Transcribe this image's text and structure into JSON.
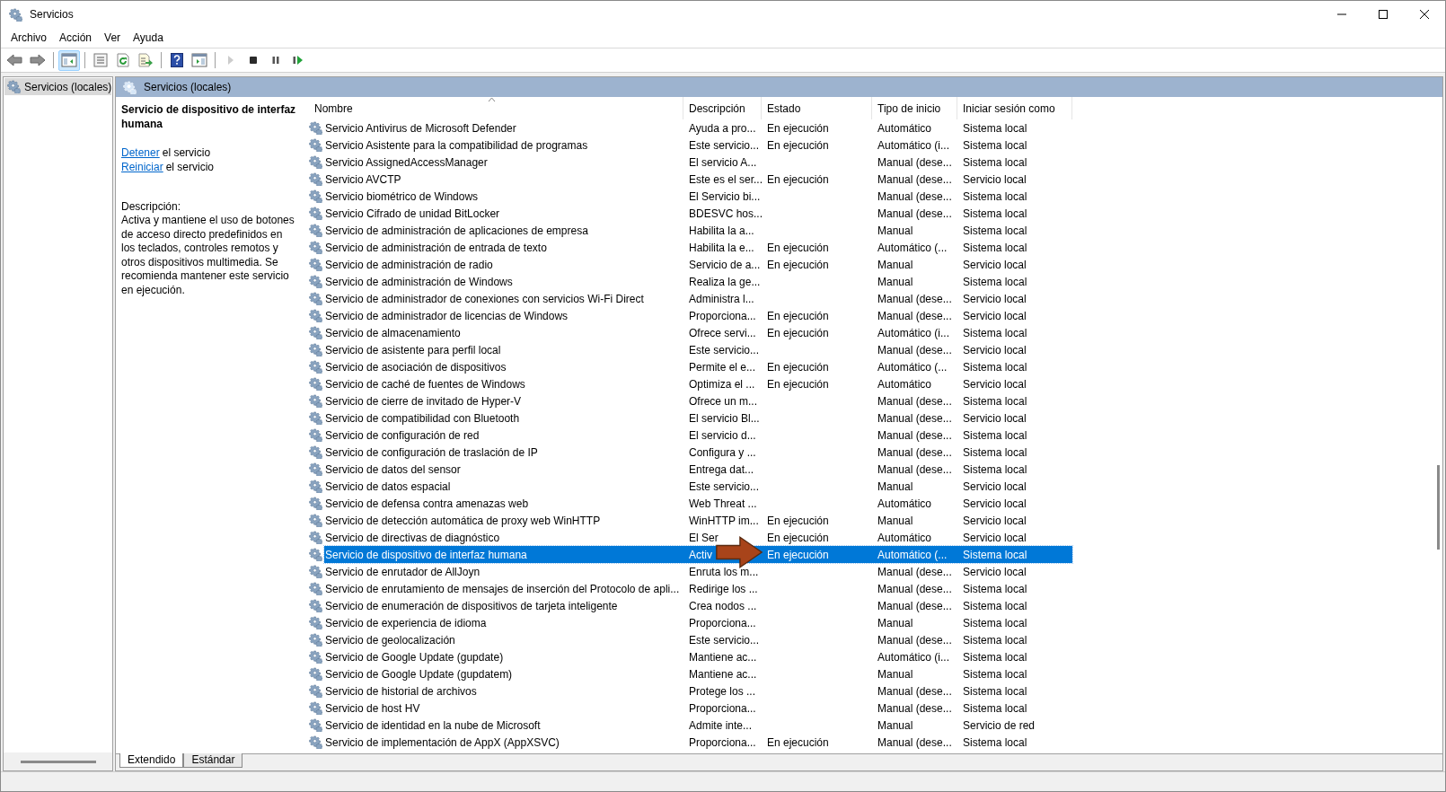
{
  "window": {
    "title": "Servicios"
  },
  "menu": [
    "Archivo",
    "Acción",
    "Ver",
    "Ayuda"
  ],
  "toolbar": [
    {
      "kind": "back",
      "selected": false,
      "disabled": false
    },
    {
      "kind": "forward",
      "selected": false,
      "disabled": false
    },
    {
      "kind": "sep"
    },
    {
      "kind": "tree",
      "selected": true,
      "disabled": false
    },
    {
      "kind": "sep"
    },
    {
      "kind": "properties",
      "selected": false,
      "disabled": false
    },
    {
      "kind": "refresh",
      "selected": false,
      "disabled": false
    },
    {
      "kind": "export",
      "selected": false,
      "disabled": false
    },
    {
      "kind": "sep"
    },
    {
      "kind": "help",
      "selected": false,
      "disabled": false
    },
    {
      "kind": "pane",
      "selected": false,
      "disabled": false
    },
    {
      "kind": "sep"
    },
    {
      "kind": "play",
      "selected": false,
      "disabled": true
    },
    {
      "kind": "stop",
      "selected": false,
      "disabled": false
    },
    {
      "kind": "pause",
      "selected": false,
      "disabled": false
    },
    {
      "kind": "resume",
      "selected": false,
      "disabled": false
    }
  ],
  "tree": {
    "items": [
      {
        "label": "Servicios (locales)",
        "selected": true
      }
    ]
  },
  "panel_header": "Servicios (locales)",
  "details": {
    "title": "Servicio de dispositivo de interfaz humana",
    "actions": [
      {
        "link": "Detener",
        "text": "el servicio"
      },
      {
        "link": "Reiniciar",
        "text": "el servicio"
      }
    ],
    "description_label": "Descripción:",
    "description": "Activa y mantiene el uso de botones de acceso directo predefinidos en los teclados, controles remotos y otros dispositivos multimedia. Se recomienda mantener este servicio en ejecución."
  },
  "table": {
    "columns": [
      {
        "label": "Nombre",
        "sorted": true
      },
      {
        "label": "Descripción",
        "sorted": false
      },
      {
        "label": "Estado",
        "sorted": false
      },
      {
        "label": "Tipo de inicio",
        "sorted": false
      },
      {
        "label": "Iniciar sesión como",
        "sorted": false
      }
    ],
    "rows": [
      {
        "name": "Servicio Antivirus de Microsoft Defender",
        "description": "Ayuda a pro...",
        "status": "En ejecución",
        "startup": "Automático",
        "logon": "Sistema local",
        "selected": false
      },
      {
        "name": "Servicio Asistente para la compatibilidad de programas",
        "description": "Este servicio...",
        "status": "En ejecución",
        "startup": "Automático (i...",
        "logon": "Sistema local",
        "selected": false
      },
      {
        "name": "Servicio AssignedAccessManager",
        "description": "El servicio A...",
        "startup": "Manual (dese...",
        "logon": "Sistema local",
        "selected": false
      },
      {
        "name": "Servicio AVCTP",
        "description": "Este es el ser...",
        "status": "En ejecución",
        "startup": "Manual (dese...",
        "logon": "Servicio local",
        "selected": false
      },
      {
        "name": "Servicio biométrico de Windows",
        "description": "El Servicio bi...",
        "startup": "Manual (dese...",
        "logon": "Sistema local",
        "selected": false
      },
      {
        "name": "Servicio Cifrado de unidad BitLocker",
        "description": "BDESVC hos...",
        "startup": "Manual (dese...",
        "logon": "Sistema local",
        "selected": false
      },
      {
        "name": "Servicio de administración de aplicaciones de empresa",
        "description": "Habilita la a...",
        "startup": "Manual",
        "logon": "Sistema local",
        "selected": false
      },
      {
        "name": "Servicio de administración de entrada de texto",
        "description": "Habilita la e...",
        "status": "En ejecución",
        "startup": "Automático (...",
        "logon": "Sistema local",
        "selected": false
      },
      {
        "name": "Servicio de administración de radio",
        "description": "Servicio de a...",
        "status": "En ejecución",
        "startup": "Manual",
        "logon": "Servicio local",
        "selected": false
      },
      {
        "name": "Servicio de administración de Windows",
        "description": "Realiza la ge...",
        "startup": "Manual",
        "logon": "Sistema local",
        "selected": false
      },
      {
        "name": "Servicio de administrador de conexiones con servicios Wi-Fi Direct",
        "description": "Administra l...",
        "startup": "Manual (dese...",
        "logon": "Servicio local",
        "selected": false
      },
      {
        "name": "Servicio de administrador de licencias de Windows",
        "description": "Proporciona...",
        "status": "En ejecución",
        "startup": "Manual (dese...",
        "logon": "Servicio local",
        "selected": false
      },
      {
        "name": "Servicio de almacenamiento",
        "description": "Ofrece servi...",
        "status": "En ejecución",
        "startup": "Automático (i...",
        "logon": "Sistema local",
        "selected": false
      },
      {
        "name": "Servicio de asistente para perfil local",
        "description": "Este servicio...",
        "startup": "Manual (dese...",
        "logon": "Servicio local",
        "selected": false
      },
      {
        "name": "Servicio de asociación de dispositivos",
        "description": "Permite el e...",
        "status": "En ejecución",
        "startup": "Automático (...",
        "logon": "Sistema local",
        "selected": false
      },
      {
        "name": "Servicio de caché de fuentes de Windows",
        "description": "Optimiza el ...",
        "status": "En ejecución",
        "startup": "Automático",
        "logon": "Servicio local",
        "selected": false
      },
      {
        "name": "Servicio de cierre de invitado de Hyper-V",
        "description": "Ofrece un m...",
        "startup": "Manual (dese...",
        "logon": "Sistema local",
        "selected": false
      },
      {
        "name": "Servicio de compatibilidad con Bluetooth",
        "description": "El servicio Bl...",
        "startup": "Manual (dese...",
        "logon": "Servicio local",
        "selected": false
      },
      {
        "name": "Servicio de configuración de red",
        "description": "El servicio d...",
        "startup": "Manual (dese...",
        "logon": "Sistema local",
        "selected": false
      },
      {
        "name": "Servicio de configuración de traslación de IP",
        "description": "Configura y ...",
        "startup": "Manual (dese...",
        "logon": "Sistema local",
        "selected": false
      },
      {
        "name": "Servicio de datos del sensor",
        "description": "Entrega dat...",
        "startup": "Manual (dese...",
        "logon": "Sistema local",
        "selected": false
      },
      {
        "name": "Servicio de datos espacial",
        "description": "Este servicio...",
        "startup": "Manual",
        "logon": "Servicio local",
        "selected": false
      },
      {
        "name": "Servicio de defensa contra amenazas web",
        "description": "Web Threat ...",
        "startup": "Automático",
        "logon": "Servicio local",
        "selected": false
      },
      {
        "name": "Servicio de detección automática de proxy web WinHTTP",
        "description": "WinHTTP im...",
        "status": "En ejecución",
        "startup": "Manual",
        "logon": "Servicio local",
        "selected": false
      },
      {
        "name": "Servicio de directivas de diagnóstico",
        "description": "El Ser",
        "status": "En ejecución",
        "startup": "Automático",
        "logon": "Servicio local",
        "selected": false
      },
      {
        "name": "Servicio de dispositivo de interfaz humana",
        "description": "Activ",
        "status": "En ejecución",
        "startup": "Automático (...",
        "logon": "Sistema local",
        "selected": true
      },
      {
        "name": "Servicio de enrutador de AllJoyn",
        "description": "Enruta los m...",
        "startup": "Manual (dese...",
        "logon": "Servicio local",
        "selected": false
      },
      {
        "name": "Servicio de enrutamiento de mensajes de inserción del Protocolo de apli...",
        "description": "Redirige los ...",
        "startup": "Manual (dese...",
        "logon": "Sistema local",
        "selected": false
      },
      {
        "name": "Servicio de enumeración de dispositivos de tarjeta inteligente",
        "description": "Crea nodos ...",
        "startup": "Manual (dese...",
        "logon": "Sistema local",
        "selected": false
      },
      {
        "name": "Servicio de experiencia de idioma",
        "description": "Proporciona...",
        "startup": "Manual",
        "logon": "Sistema local",
        "selected": false
      },
      {
        "name": "Servicio de geolocalización",
        "description": "Este servicio...",
        "startup": "Manual (dese...",
        "logon": "Sistema local",
        "selected": false
      },
      {
        "name": "Servicio de Google Update (gupdate)",
        "description": "Mantiene ac...",
        "startup": "Automático (i...",
        "logon": "Sistema local",
        "selected": false
      },
      {
        "name": "Servicio de Google Update (gupdatem)",
        "description": "Mantiene ac...",
        "startup": "Manual",
        "logon": "Sistema local",
        "selected": false
      },
      {
        "name": "Servicio de historial de archivos",
        "description": "Protege los ...",
        "startup": "Manual (dese...",
        "logon": "Sistema local",
        "selected": false
      },
      {
        "name": "Servicio de host HV",
        "description": "Proporciona...",
        "startup": "Manual (dese...",
        "logon": "Sistema local",
        "selected": false
      },
      {
        "name": "Servicio de identidad en la nube de Microsoft",
        "description": "Admite inte...",
        "startup": "Manual",
        "logon": "Servicio de red",
        "selected": false
      },
      {
        "name": "Servicio de implementación de AppX (AppXSVC)",
        "description": "Proporciona...",
        "status": "En ejecución",
        "startup": "Manual (dese...",
        "logon": "Sistema local",
        "selected": false
      }
    ]
  },
  "bottom_tabs": [
    {
      "label": "Extendido",
      "selected": true
    },
    {
      "label": "Estándar",
      "selected": false
    }
  ]
}
